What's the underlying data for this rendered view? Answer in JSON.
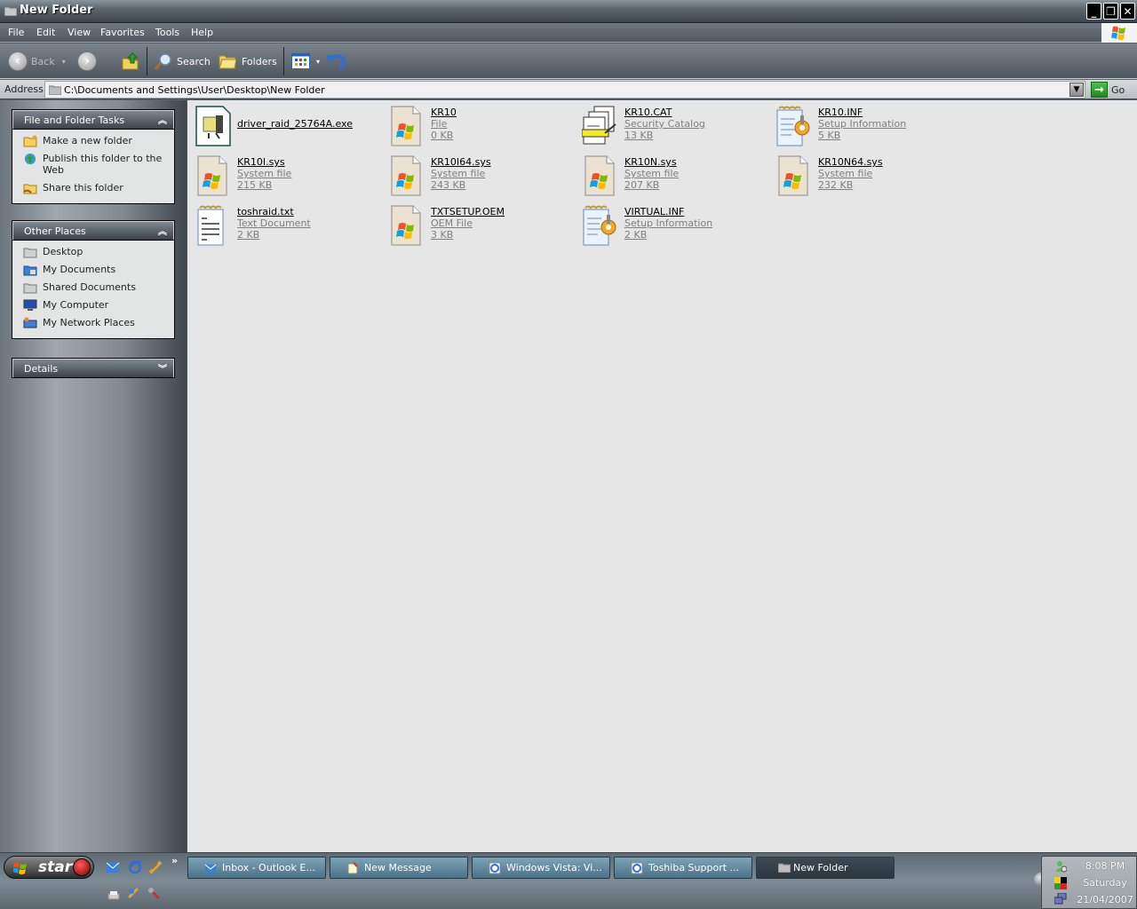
{
  "window": {
    "title": "New Folder",
    "controls": {
      "minimize": "_",
      "restore": "❐",
      "close": "✕"
    }
  },
  "menu": [
    "File",
    "Edit",
    "View",
    "Favorites",
    "Tools",
    "Help"
  ],
  "toolbar": {
    "back_label": "Back",
    "search_label": "Search",
    "folders_label": "Folders"
  },
  "address": {
    "label": "Address",
    "value": "C:\\Documents and Settings\\User\\Desktop\\New Folder",
    "go_label": "Go"
  },
  "sidebar": {
    "file_tasks": {
      "title": "File and Folder Tasks",
      "items": [
        {
          "label": "Make a new folder",
          "icon": "new-folder-icon"
        },
        {
          "label": "Publish this folder to the Web",
          "icon": "publish-web-icon"
        },
        {
          "label": "Share this folder",
          "icon": "share-folder-icon"
        }
      ]
    },
    "other_places": {
      "title": "Other Places",
      "items": [
        {
          "label": "Desktop",
          "icon": "desktop-icon"
        },
        {
          "label": "My Documents",
          "icon": "my-documents-icon"
        },
        {
          "label": "Shared Documents",
          "icon": "shared-documents-icon"
        },
        {
          "label": "My Computer",
          "icon": "my-computer-icon"
        },
        {
          "label": "My Network Places",
          "icon": "network-places-icon"
        }
      ]
    },
    "details": {
      "title": "Details"
    }
  },
  "files": [
    {
      "name": "driver_raid_25764A.exe",
      "type": "",
      "size": "",
      "icon": "exe-installer-icon"
    },
    {
      "name": "KR10",
      "type": "File",
      "size": "0 KB",
      "icon": "system-file-icon"
    },
    {
      "name": "KR10.CAT",
      "type": "Security Catalog",
      "size": "13 KB",
      "icon": "security-catalog-icon"
    },
    {
      "name": "KR10.INF",
      "type": "Setup Information",
      "size": "5 KB",
      "icon": "setup-info-icon"
    },
    {
      "name": "KR10I.sys",
      "type": "System file",
      "size": "215 KB",
      "icon": "system-file-icon"
    },
    {
      "name": "KR10I64.sys",
      "type": "System file",
      "size": "243 KB",
      "icon": "system-file-icon"
    },
    {
      "name": "KR10N.sys",
      "type": "System file",
      "size": "207 KB",
      "icon": "system-file-icon"
    },
    {
      "name": "KR10N64.sys",
      "type": "System file",
      "size": "232 KB",
      "icon": "system-file-icon"
    },
    {
      "name": "toshraid.txt",
      "type": "Text Document",
      "size": "2 KB",
      "icon": "text-document-icon"
    },
    {
      "name": "TXTSETUP.OEM",
      "type": "OEM File",
      "size": "3 KB",
      "icon": "system-file-icon"
    },
    {
      "name": "VIRTUAL.INF",
      "type": "Setup Information",
      "size": "2 KB",
      "icon": "setup-info-icon"
    }
  ],
  "taskbar": {
    "start_label": "start",
    "more_label": "»",
    "buttons": [
      {
        "label": "Inbox - Outlook E...",
        "icon": "outlook-icon",
        "active": false
      },
      {
        "label": "New Message",
        "icon": "new-message-icon",
        "active": false
      },
      {
        "label": "Windows Vista: Vi...",
        "icon": "ie-icon",
        "active": false
      },
      {
        "label": "Toshiba Support ...",
        "icon": "ie-icon",
        "active": false
      },
      {
        "label": "New Folder",
        "icon": "folder-icon",
        "active": true
      }
    ],
    "clock": {
      "time": "8:08 PM",
      "day": "Saturday",
      "date": "21/04/2007"
    }
  },
  "colors": {
    "content_bg": "#e6e6e6",
    "panel_bg": "#e3e4e4",
    "taskbar_button": "#5e8598",
    "file_meta": "#808080"
  }
}
